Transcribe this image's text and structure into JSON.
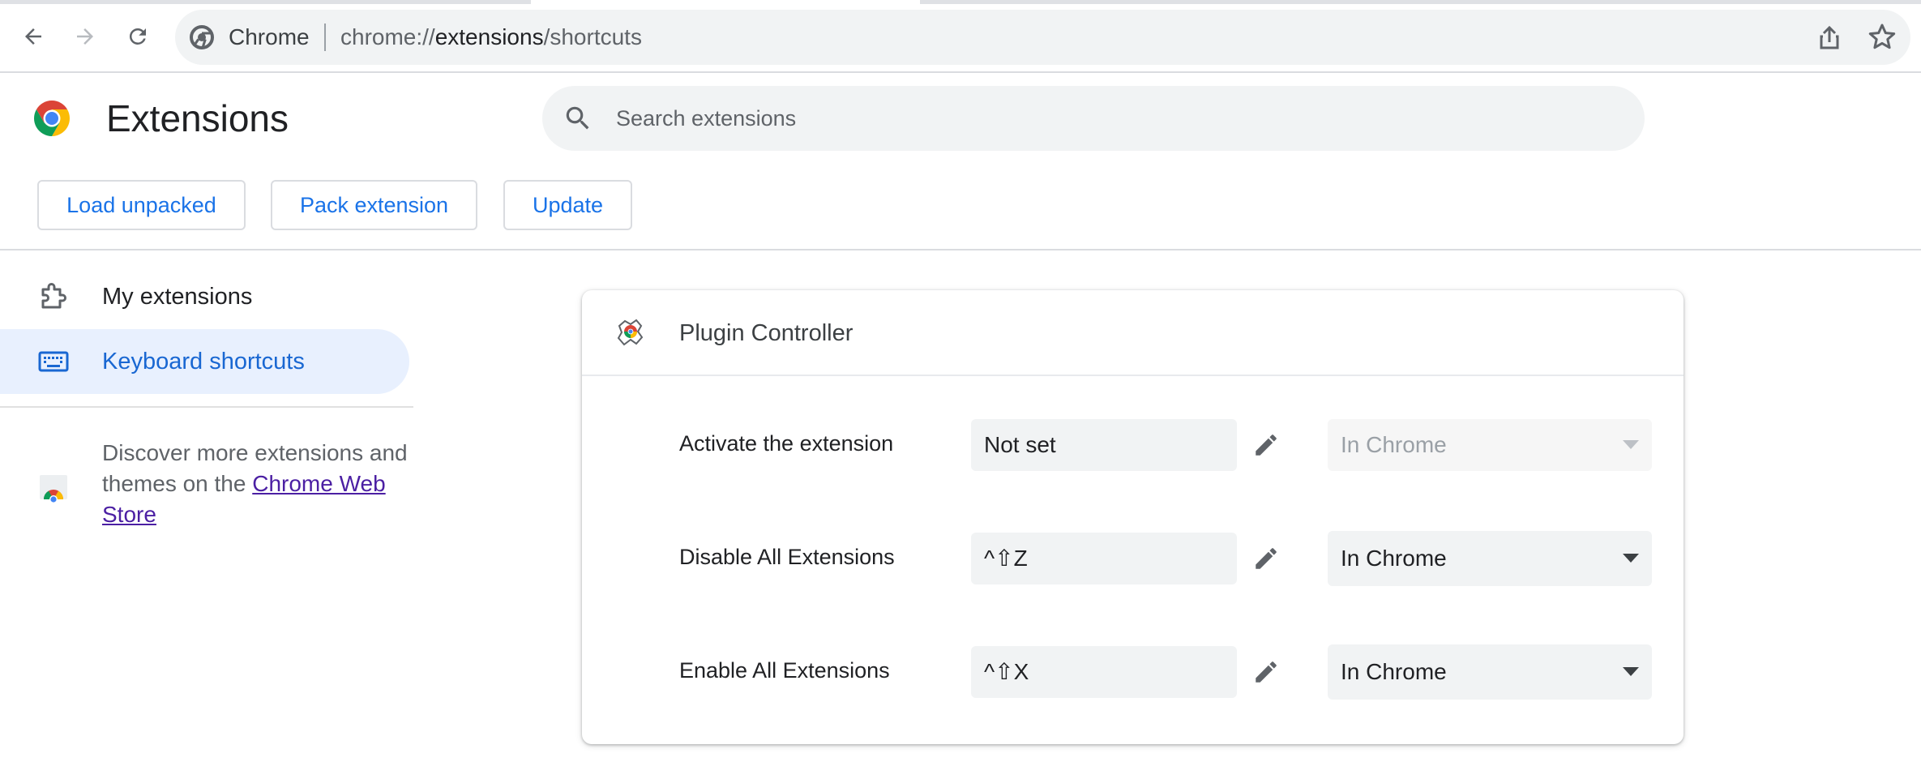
{
  "browser": {
    "chip_label": "Chrome",
    "url_prefix": "chrome://",
    "url_host": "extensions",
    "url_path": "/shortcuts"
  },
  "header": {
    "title": "Extensions",
    "search_placeholder": "Search extensions"
  },
  "toolbar": {
    "load_unpacked": "Load unpacked",
    "pack_extension": "Pack extension",
    "update": "Update"
  },
  "sidebar": {
    "items": [
      {
        "label": "My extensions",
        "active": false
      },
      {
        "label": "Keyboard shortcuts",
        "active": true
      }
    ],
    "store_text_before": "Discover more extensions and themes on the ",
    "store_link": "Chrome Web Store"
  },
  "card": {
    "extension_name": "Plugin Controller",
    "commands": [
      {
        "label": "Activate the extension",
        "shortcut": "Not set",
        "scope": "In Chrome",
        "scope_disabled": true
      },
      {
        "label": "Disable All Extensions",
        "shortcut": "^⇧Z",
        "scope": "In Chrome",
        "scope_disabled": false
      },
      {
        "label": "Enable All Extensions",
        "shortcut": "^⇧X",
        "scope": "In Chrome",
        "scope_disabled": false
      }
    ]
  },
  "colors": {
    "accent": "#1a73e8",
    "active_bg": "#e8f0fe",
    "link_visited": "#4b1fa3"
  }
}
